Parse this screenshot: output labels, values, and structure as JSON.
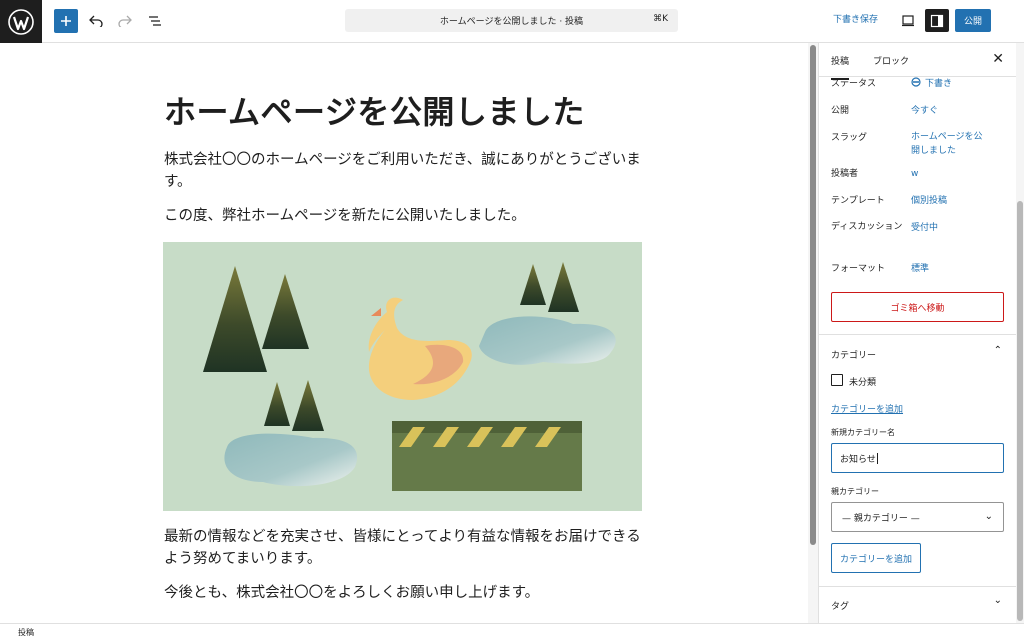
{
  "toolbar": {
    "command_title": "ホームページを公開しました · 投稿",
    "shortcut": "⌘K",
    "save_draft": "下書き保存",
    "publish": "公開"
  },
  "post": {
    "title": "ホームページを公開しました",
    "paragraphs": [
      "株式会社〇〇のホームページをご利用いただき、誠にありがとうございます。",
      "この度、弊社ホームページを新たに公開いたしました。",
      "最新の情報などを充実させ、皆様にとってより有益な情報をお届けできるよう努めてまいります。",
      "今後とも、株式会社〇〇をよろしくお願い申し上げます。"
    ]
  },
  "sidebar": {
    "tabs": [
      "投稿",
      "ブロック"
    ],
    "rows": [
      {
        "label": "ステータス",
        "value": "下書き"
      },
      {
        "label": "公開",
        "value": "今すぐ"
      },
      {
        "label": "スラッグ",
        "value": "ホームページを公開しました"
      },
      {
        "label": "投稿者",
        "value": "w"
      },
      {
        "label": "テンプレート",
        "value": "個別投稿"
      },
      {
        "label": "ディスカッション",
        "value": "受付中"
      },
      {
        "label": "フォーマット",
        "value": "標準"
      }
    ],
    "trash": "ゴミ箱へ移動",
    "category_section": "カテゴリー",
    "category_option": "未分類",
    "add_category_link": "カテゴリーを追加",
    "new_category_label": "新規カテゴリー名",
    "new_category_value": "お知らせ",
    "parent_category_label": "親カテゴリー",
    "parent_category_value": "— 親カテゴリー —",
    "add_category_button": "カテゴリーを追加",
    "tag_section": "タグ"
  },
  "footer": {
    "breadcrumb": "投稿"
  },
  "colors": {
    "accent": "#2271b1",
    "danger": "#cc1818",
    "dark": "#1e1e1e"
  }
}
